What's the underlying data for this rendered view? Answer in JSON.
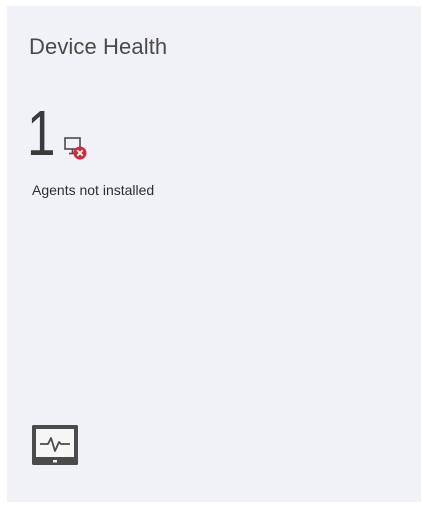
{
  "tile": {
    "title": "Device Health",
    "metric": {
      "value": "1",
      "label": "Agents not installed",
      "icon": "device-error-icon"
    },
    "footer_icon": "health-monitor-icon"
  },
  "colors": {
    "tile_background": "#f1f2f7",
    "text_primary": "#3a3a3a",
    "error_badge": "#d9273a",
    "icon_dark": "#4b4b4b"
  }
}
